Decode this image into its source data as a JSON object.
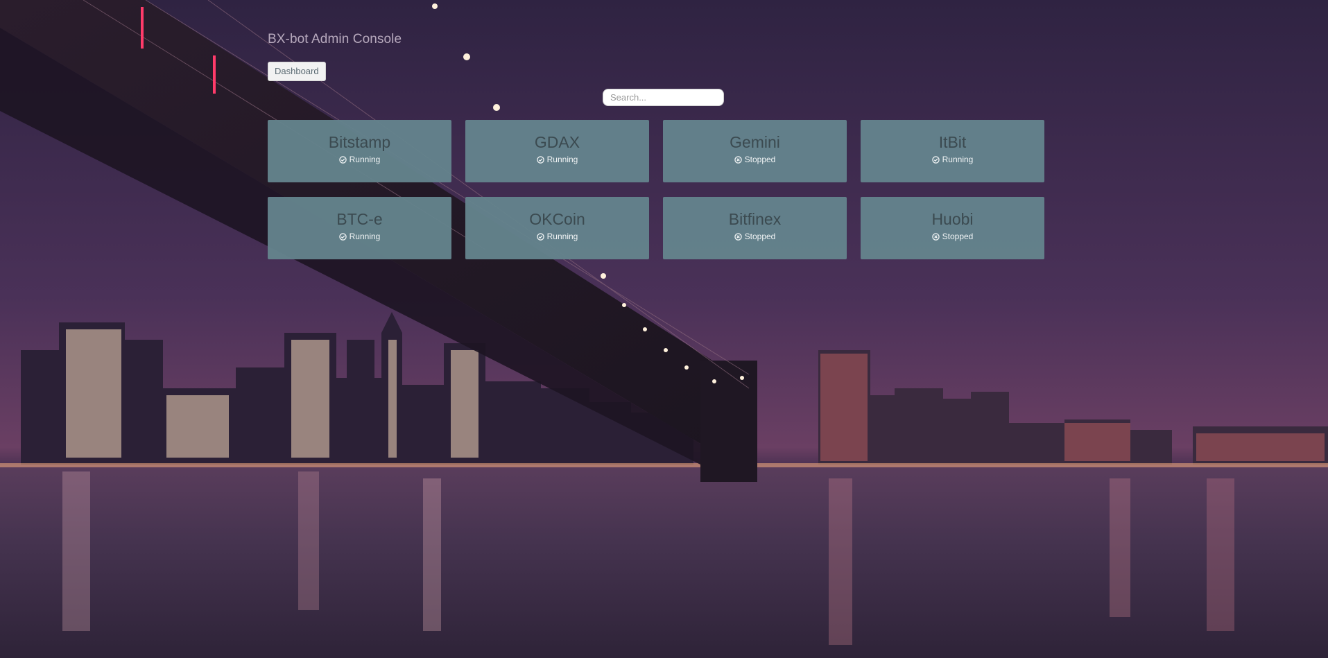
{
  "app": {
    "title": "BX-bot Admin Console"
  },
  "nav": {
    "dashboard_label": "Dashboard"
  },
  "search": {
    "placeholder": "Search...",
    "value": ""
  },
  "exchanges": [
    {
      "name": "Bitstamp",
      "status": "Running",
      "status_icon": "check-circle-icon"
    },
    {
      "name": "GDAX",
      "status": "Running",
      "status_icon": "check-circle-icon"
    },
    {
      "name": "Gemini",
      "status": "Stopped",
      "status_icon": "times-circle-icon"
    },
    {
      "name": "ItBit",
      "status": "Running",
      "status_icon": "check-circle-icon"
    },
    {
      "name": "BTC-e",
      "status": "Running",
      "status_icon": "check-circle-icon"
    },
    {
      "name": "OKCoin",
      "status": "Running",
      "status_icon": "check-circle-icon"
    },
    {
      "name": "Bitfinex",
      "status": "Stopped",
      "status_icon": "times-circle-icon"
    },
    {
      "name": "Huobi",
      "status": "Stopped",
      "status_icon": "times-circle-icon"
    }
  ],
  "colors": {
    "tile_bg": "#64838c",
    "tile_name": "#3b4a50",
    "title_text": "#b7a9bd"
  }
}
